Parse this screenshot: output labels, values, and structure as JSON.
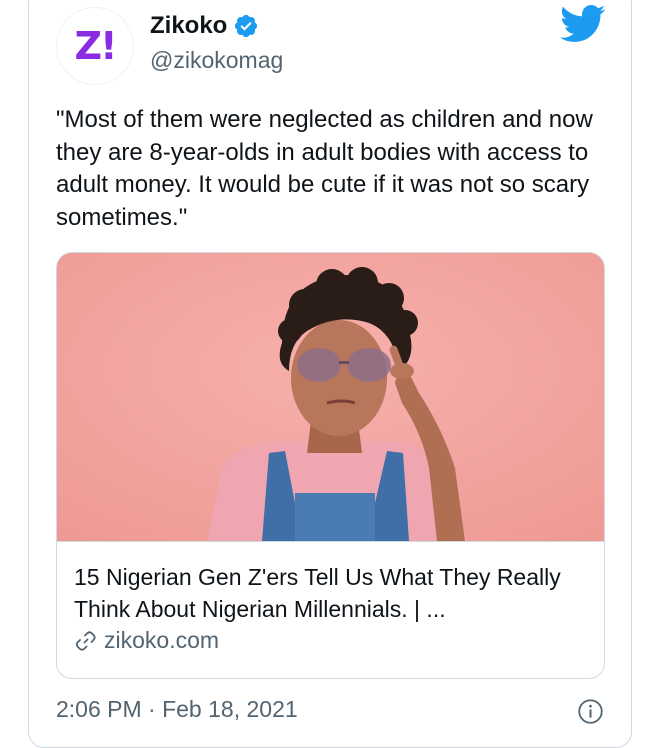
{
  "tweet": {
    "author": {
      "avatar_text": "Z!",
      "name": "Zikoko",
      "handle": "@zikokomag",
      "verified": true,
      "brand_color": "#8a2be2"
    },
    "text": "\"Most of them were neglected as children and now they are 8-year-olds in adult bodies with access to adult money. It would be cute if it was not so scary sometimes.\"",
    "link_card": {
      "image_icon": "photo-woman-thinking",
      "title": "15 Nigerian Gen Z'ers Tell Us What They Really Think About Nigerian Millennials. | ...",
      "domain": "zikoko.com"
    },
    "timestamp": "2:06 PM · Feb 18, 2021",
    "icons": {
      "platform": "twitter-bird-icon",
      "info": "info-icon",
      "link": "link-icon",
      "verified": "verified-badge-icon"
    },
    "colors": {
      "twitter_blue": "#1d9bf0",
      "secondary_text": "#536471",
      "border": "#cfd9de"
    }
  }
}
